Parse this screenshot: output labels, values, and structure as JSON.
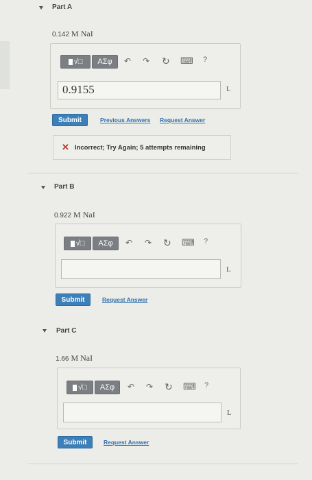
{
  "parts": [
    {
      "label": "Part A",
      "formula_num": "0.142",
      "formula_rest": "M NaI",
      "answer_value": "0.9155",
      "unit": "L",
      "submit": "Submit",
      "prev_answers": "Previous Answers",
      "request_answer": "Request Answer",
      "feedback": "Incorrect; Try Again; 5 attempts remaining"
    },
    {
      "label": "Part B",
      "formula_num": "0.922",
      "formula_rest": "M NaI",
      "answer_value": "",
      "unit": "L",
      "submit": "Submit",
      "request_answer": "Request Answer"
    },
    {
      "label": "Part C",
      "formula_num": "1.66",
      "formula_rest": "M NaI",
      "answer_value": "",
      "unit": "L",
      "submit": "Submit",
      "request_answer": "Request Answer"
    }
  ],
  "toolbar": {
    "templates_label": "√□",
    "symbols_label": "ΑΣφ",
    "undo": "↶",
    "redo": "↷",
    "reset": "↻",
    "keyboard": "⌨",
    "help": "?"
  },
  "icons": {
    "collapse": "caret-down-icon",
    "incorrect": "x-mark-icon"
  },
  "colors": {
    "submit": "#3d7fb8",
    "link": "#2f6fad",
    "incorrect": "#c0392b"
  }
}
